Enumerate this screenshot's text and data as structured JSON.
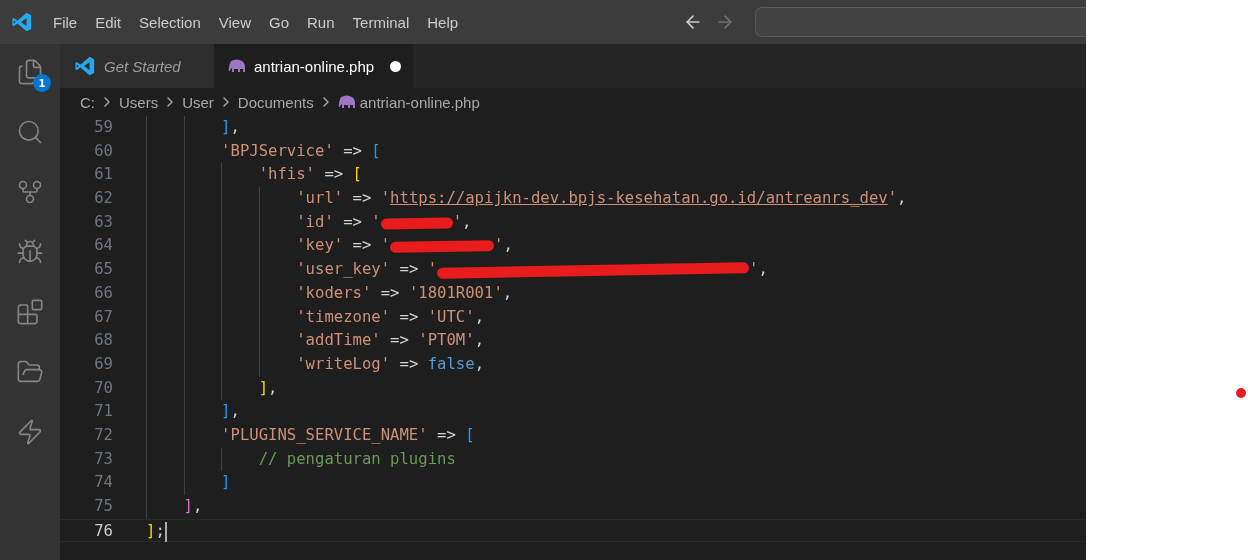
{
  "menu": [
    "File",
    "Edit",
    "Selection",
    "View",
    "Go",
    "Run",
    "Terminal",
    "Help"
  ],
  "navigation": {
    "back_disabled": false,
    "forward_disabled": true
  },
  "activity_bar": [
    {
      "kind": "explorer",
      "badge": "1"
    },
    {
      "kind": "search"
    },
    {
      "kind": "source-control"
    },
    {
      "kind": "run-debug"
    },
    {
      "kind": "extensions"
    },
    {
      "kind": "folders"
    },
    {
      "kind": "lightning"
    }
  ],
  "tabs": [
    {
      "label": "Get Started",
      "kind": "welcome",
      "selected": false,
      "modified": false
    },
    {
      "label": "antrian-online.php",
      "kind": "php",
      "selected": true,
      "modified": true
    }
  ],
  "breadcrumb": [
    {
      "label": "C:",
      "kind": "folder"
    },
    {
      "label": "Users",
      "kind": "folder"
    },
    {
      "label": "User",
      "kind": "folder"
    },
    {
      "label": "Documents",
      "kind": "folder"
    },
    {
      "label": "antrian-online.php",
      "kind": "php"
    }
  ],
  "code_lines": [
    {
      "number": "59",
      "current": false,
      "tokens": [
        {
          "kind": "bracket",
          "text": "        ]",
          "color": "#179fff"
        },
        {
          "kind": "op",
          "text": ","
        }
      ]
    },
    {
      "number": "60",
      "current": false,
      "tokens": [
        {
          "kind": "string",
          "text": "        'BPJService'"
        },
        {
          "kind": "op",
          "text": " => "
        },
        {
          "kind": "bracket",
          "text": "[",
          "color": "#179fff"
        }
      ]
    },
    {
      "number": "61",
      "current": false,
      "tokens": [
        {
          "kind": "string",
          "text": "            'hfis'"
        },
        {
          "kind": "op",
          "text": " => "
        },
        {
          "kind": "bracket",
          "text": "[",
          "color": "#ffd700"
        }
      ]
    },
    {
      "number": "62",
      "current": false,
      "tokens": [
        {
          "kind": "string",
          "text": "                'url'"
        },
        {
          "kind": "op",
          "text": " => "
        },
        {
          "kind": "string",
          "text": "'"
        },
        {
          "kind": "link",
          "text": "https://apijkn-dev.bpjs-kesehatan.go.id/antreanrs_dev"
        },
        {
          "kind": "string",
          "text": "'"
        },
        {
          "kind": "op",
          "text": ","
        }
      ]
    },
    {
      "number": "63",
      "current": false,
      "tokens": [
        {
          "kind": "string",
          "text": "                'id'"
        },
        {
          "kind": "op",
          "text": " => "
        },
        {
          "kind": "string",
          "text": "'"
        },
        {
          "kind": "redacted-short"
        },
        {
          "kind": "string",
          "text": "'"
        },
        {
          "kind": "op",
          "text": ","
        }
      ]
    },
    {
      "number": "64",
      "current": false,
      "tokens": [
        {
          "kind": "string",
          "text": "                'key'"
        },
        {
          "kind": "op",
          "text": " => "
        },
        {
          "kind": "string",
          "text": "'"
        },
        {
          "kind": "redacted-medium"
        },
        {
          "kind": "string",
          "text": "'"
        },
        {
          "kind": "op",
          "text": ","
        }
      ]
    },
    {
      "number": "65",
      "current": false,
      "tokens": [
        {
          "kind": "string",
          "text": "                'user_key'"
        },
        {
          "kind": "op",
          "text": " => "
        },
        {
          "kind": "string",
          "text": "'"
        },
        {
          "kind": "redacted-long"
        },
        {
          "kind": "string",
          "text": "'"
        },
        {
          "kind": "op",
          "text": ","
        }
      ]
    },
    {
      "number": "66",
      "current": false,
      "tokens": [
        {
          "kind": "string",
          "text": "                'koders'"
        },
        {
          "kind": "op",
          "text": " => "
        },
        {
          "kind": "string",
          "text": "'1801R001'"
        },
        {
          "kind": "op",
          "text": ","
        }
      ]
    },
    {
      "number": "67",
      "current": false,
      "tokens": [
        {
          "kind": "string",
          "text": "                'timezone'"
        },
        {
          "kind": "op",
          "text": " => "
        },
        {
          "kind": "string",
          "text": "'UTC'"
        },
        {
          "kind": "op",
          "text": ","
        }
      ]
    },
    {
      "number": "68",
      "current": false,
      "tokens": [
        {
          "kind": "string",
          "text": "                'addTime'"
        },
        {
          "kind": "op",
          "text": " => "
        },
        {
          "kind": "string",
          "text": "'PT0M'"
        },
        {
          "kind": "op",
          "text": ","
        }
      ]
    },
    {
      "number": "69",
      "current": false,
      "tokens": [
        {
          "kind": "string",
          "text": "                'writeLog'"
        },
        {
          "kind": "op",
          "text": " => "
        },
        {
          "kind": "keyword",
          "text": "false"
        },
        {
          "kind": "op",
          "text": ","
        }
      ]
    },
    {
      "number": "70",
      "current": false,
      "tokens": [
        {
          "kind": "bracket",
          "text": "            ]",
          "color": "#ffd700"
        },
        {
          "kind": "op",
          "text": ","
        }
      ]
    },
    {
      "number": "71",
      "current": false,
      "tokens": [
        {
          "kind": "bracket",
          "text": "        ]",
          "color": "#179fff"
        },
        {
          "kind": "op",
          "text": ","
        }
      ]
    },
    {
      "number": "72",
      "current": false,
      "tokens": [
        {
          "kind": "string",
          "text": "        'PLUGINS_SERVICE_NAME'"
        },
        {
          "kind": "op",
          "text": " => "
        },
        {
          "kind": "bracket",
          "text": "[",
          "color": "#179fff"
        }
      ]
    },
    {
      "number": "73",
      "current": false,
      "tokens": [
        {
          "kind": "comment",
          "text": "            // pengaturan plugins"
        }
      ]
    },
    {
      "number": "74",
      "current": false,
      "tokens": [
        {
          "kind": "bracket",
          "text": "        ]",
          "color": "#179fff"
        }
      ]
    },
    {
      "number": "75",
      "current": false,
      "tokens": [
        {
          "kind": "bracket",
          "text": "    ]",
          "color": "#da70d6"
        },
        {
          "kind": "op",
          "text": ","
        }
      ]
    },
    {
      "number": "76",
      "current": true,
      "tokens": [
        {
          "kind": "bracket",
          "text": "]",
          "color": "#ffd700"
        },
        {
          "kind": "op",
          "text": ";"
        }
      ]
    }
  ]
}
